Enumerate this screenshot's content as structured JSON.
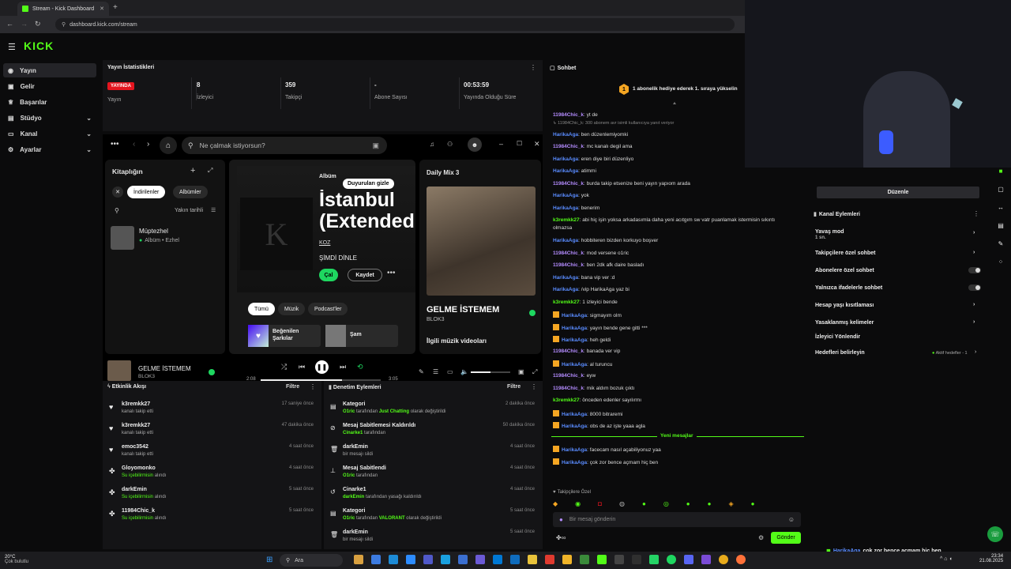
{
  "browser": {
    "tab_title": "Stream - Kick Dashboard",
    "url": "dashboard.kick.com/stream"
  },
  "header": {
    "logo": "KICK"
  },
  "sidebar": {
    "items": [
      {
        "label": "Yayın",
        "icon": "broadcast-icon"
      },
      {
        "label": "Gelir",
        "icon": "money-icon"
      },
      {
        "label": "Başarılar",
        "icon": "trophy-icon"
      },
      {
        "label": "Stüdyo",
        "icon": "studio-icon"
      },
      {
        "label": "Kanal",
        "icon": "channel-icon"
      },
      {
        "label": "Ayarlar",
        "icon": "gear-icon"
      }
    ]
  },
  "stats": {
    "title": "Yayın İstatistikleri",
    "live_badge": "YAYINDA",
    "items": [
      {
        "value": "",
        "label": "Yayın"
      },
      {
        "value": "8",
        "label": "İzleyici"
      },
      {
        "value": "359",
        "label": "Takipçi"
      },
      {
        "value": "-",
        "label": "Abone Sayısı"
      },
      {
        "value": "00:53:59",
        "label": "Yayında Olduğu Süre"
      }
    ]
  },
  "spotify": {
    "search_placeholder": "Ne çalmak istiyorsun?",
    "library_title": "Kitaplığın",
    "filter_downloaded": "İndirilenler",
    "filter_albums": "Albümler",
    "sort_label": "Yakın tarihli",
    "lib_item_title": "Müptezhel",
    "lib_item_sub": "Albüm • Ezhel",
    "album_type": "Albüm",
    "album_title_1": "İstanbul",
    "album_title_2": "(Extended",
    "album_artist": "KOZ",
    "now_playing_label": "ŞİMDİ DİNLE",
    "hide_ads": "Duyuruları gizle",
    "play_btn": "Çal",
    "save_btn": "Kaydet",
    "chips": [
      "Tümü",
      "Müzik",
      "Podcast'ler"
    ],
    "liked_songs": "Beğenilen Şarkılar",
    "sam": "Şam",
    "daily_mix": "Daily Mix 3",
    "mix_song": "GELME İSTEMEM",
    "mix_artist": "BLOK3",
    "related_videos": "İlgili müzik videoları",
    "track_title": "GELME İSTEMEM",
    "track_artist": "BLOK3",
    "time_elapsed": "2:08",
    "time_total": "3:05"
  },
  "activity": {
    "title": "Etkinlik Akışı",
    "filter": "Filtre",
    "items": [
      {
        "name": "k3remkk27",
        "sub": "kanalı takip etti",
        "time": "17 saniye önce",
        "icon": "heart-icon"
      },
      {
        "name": "k3remkk27",
        "sub": "kanalı takip etti",
        "time": "47 dakika önce",
        "icon": "heart-icon"
      },
      {
        "name": "emoc3542",
        "sub": "kanalı takip etti",
        "time": "4 saat önce",
        "icon": "heart-icon"
      },
      {
        "name": "Gloyomonko",
        "sub": "Su içebilirmisin",
        "sub2": "alındı",
        "time": "4 saat önce",
        "icon": "reward-icon"
      },
      {
        "name": "darkEmin",
        "sub": "Su içebilirmisin",
        "sub2": "alındı",
        "time": "5 saat önce",
        "icon": "reward-icon"
      },
      {
        "name": "11984Chic_k",
        "sub": "Su içebilirmisin",
        "sub2": "alındı",
        "time": "5 saat önce",
        "icon": "reward-icon"
      }
    ]
  },
  "moderation": {
    "title": "Denetim Eylemleri",
    "filter": "Filtre",
    "items": [
      {
        "name": "Kategori",
        "hl": "O1ric",
        "mid": "tarafından",
        "hl2": "Just Chatting",
        "tail": "olarak değiştirildi",
        "time": "2 dakika önce",
        "icon": "category-icon"
      },
      {
        "name": "Mesaj Sabitlemesi Kaldırıldı",
        "hl": "Cinarke1",
        "mid": "tarafından",
        "hl2": "",
        "tail": "",
        "time": "50 dakika önce",
        "icon": "unpin-icon"
      },
      {
        "name": "darkEmin",
        "hl": "",
        "mid": "bir mesajı sildi",
        "hl2": "",
        "tail": "",
        "time": "4 saat önce",
        "icon": "trash-icon"
      },
      {
        "name": "Mesaj Sabitlendi",
        "hl": "O1ric",
        "mid": "tarafından",
        "hl2": "",
        "tail": "",
        "time": "4 saat önce",
        "icon": "pin-icon"
      },
      {
        "name": "Cinarke1",
        "hl": "darkEmin",
        "mid": "tarafından yasağı kaldırıldı",
        "hl2": "",
        "tail": "",
        "time": "4 saat önce",
        "icon": "unban-icon"
      },
      {
        "name": "Kategori",
        "hl": "O1ric",
        "mid": "tarafından",
        "hl2": "VALORANT",
        "tail": "olarak değiştirildi",
        "time": "5 saat önce",
        "icon": "category-icon"
      },
      {
        "name": "darkEmin",
        "hl": "",
        "mid": "bir mesajı sildi",
        "hl2": "",
        "tail": "",
        "time": "5 saat önce",
        "icon": "trash-icon"
      }
    ]
  },
  "chat": {
    "title": "Sohbet",
    "goal_badge": "1",
    "goal_text": "1 abonelik hediye ederek 1. sıraya yükselin",
    "new_messages": "Yeni mesajlar",
    "followers_only": "Takipçilere Özel",
    "input_placeholder": "Bir mesaj gönderin",
    "send": "Gönder",
    "messages": [
      {
        "user": "11984Chic_k",
        "color": "#b48cff",
        "text": "yt de"
      },
      {
        "reply": "11984Chic_k: 300 abonem avr isimli kullanıcıya yanıt veriyor"
      },
      {
        "user": "HarikaAga",
        "color": "#5a8cff",
        "text": "ben düzenlemiyomki"
      },
      {
        "user": "11984Chic_k",
        "color": "#b48cff",
        "text": "mc kanalı degil ama"
      },
      {
        "user": "HarikaAga",
        "color": "#5a8cff",
        "text": "eren diye biri düzenliyo"
      },
      {
        "user": "HarikaAga",
        "color": "#5a8cff",
        "text": "atimmi"
      },
      {
        "user": "11984Chic_k",
        "color": "#b48cff",
        "text": "burda takip etsenize beni yayın yapıom arada"
      },
      {
        "user": "HarikaAga",
        "color": "#5a8cff",
        "text": "yok"
      },
      {
        "user": "HarikaAga",
        "color": "#5a8cff",
        "text": "benerim"
      },
      {
        "user": "k3remkk27",
        "color": "#53fc18",
        "text": "abi hiç işin yoksa arkadasımla daha yeni acıtgım sw vatr puanlamak istermisin sıkıntı"
      },
      {
        "cont": "olmazsa"
      },
      {
        "user": "HarikaAga",
        "color": "#5a8cff",
        "text": "hobbiteren bizden korkuyo boşver"
      },
      {
        "user": "11984Chic_k",
        "color": "#b48cff",
        "text": "mod versene o1ric"
      },
      {
        "user": "11984Chic_k",
        "color": "#b48cff",
        "text": "ben 2dk afk daire basladı"
      },
      {
        "user": "HarikaAga",
        "color": "#5a8cff",
        "text": "bana vip ver :d"
      },
      {
        "user": "HarikaAga",
        "color": "#5a8cff",
        "text": "/vip HarikaAga yaz bi"
      },
      {
        "user": "k3remkk27",
        "color": "#53fc18",
        "text": "1 izleyici bende"
      },
      {
        "user": "HarikaAga",
        "color": "#5a8cff",
        "badge": true,
        "text": "sigmayım olm"
      },
      {
        "user": "HarikaAga",
        "color": "#5a8cff",
        "badge": true,
        "text": "yayın bende gene gitti ***"
      },
      {
        "user": "HarikaAga",
        "color": "#5a8cff",
        "badge": true,
        "text": "heh geldi"
      },
      {
        "user": "11984Chic_k",
        "color": "#b48cff",
        "text": "banada ver vip"
      },
      {
        "user": "HarikaAga",
        "color": "#5a8cff",
        "badge": true,
        "text": "al turuncu"
      },
      {
        "user": "11984Chic_k",
        "color": "#b48cff",
        "text": "eyw"
      },
      {
        "user": "11984Chic_k",
        "color": "#b48cff",
        "text": "mik aldım bozuk çıktı"
      },
      {
        "user": "k3remkk27",
        "color": "#53fc18",
        "text": "önceden edenler sayılırmı"
      },
      {
        "user": "HarikaAga",
        "color": "#5a8cff",
        "badge": true,
        "text": "8000 bitraremi"
      },
      {
        "user": "HarikaAga",
        "color": "#5a8cff",
        "badge": true,
        "text": "obs de az işte yaaa agla"
      }
    ],
    "new_msgs": [
      {
        "user": "HarikaAga",
        "color": "#5a8cff",
        "badge": true,
        "text": "facecam nasıl açabiliyonuz yaa"
      },
      {
        "user": "HarikaAga",
        "color": "#5a8cff",
        "badge": true,
        "text": "çok zor bence açmam hiç ben"
      }
    ]
  },
  "channel_actions": {
    "edit": "Düzenle",
    "title": "Kanal Eylemleri",
    "slow_mode": "Yavaş mod",
    "slow_mode_val": "1 sn.",
    "followers_chat": "Takipçilere özel sohbet",
    "subs_chat": "Abonelere özel sohbet",
    "emotes_chat": "Yalnızca ifadelerle sohbet",
    "age_restrict": "Hesap yaşı kısıtlaması",
    "banned_words": "Yasaklanmış kelimeler",
    "viewer_redirect": "İzleyici Yönlendir",
    "set_goals": "Hedefleri belirleyin",
    "active_goals": "Aktif hedefler - 1"
  },
  "overlay_msg": {
    "user": "HarikaAga",
    "text": "çok zor bence açmam hiç ben"
  },
  "taskbar": {
    "weather_temp": "20°C",
    "weather_desc": "Çok bulutlu",
    "search": "Ara",
    "time": "23:34",
    "date": "21.08.2025"
  },
  "colors": {
    "accent": "#53fc18",
    "live": "#e4151f",
    "spotify_green": "#1ed760"
  }
}
